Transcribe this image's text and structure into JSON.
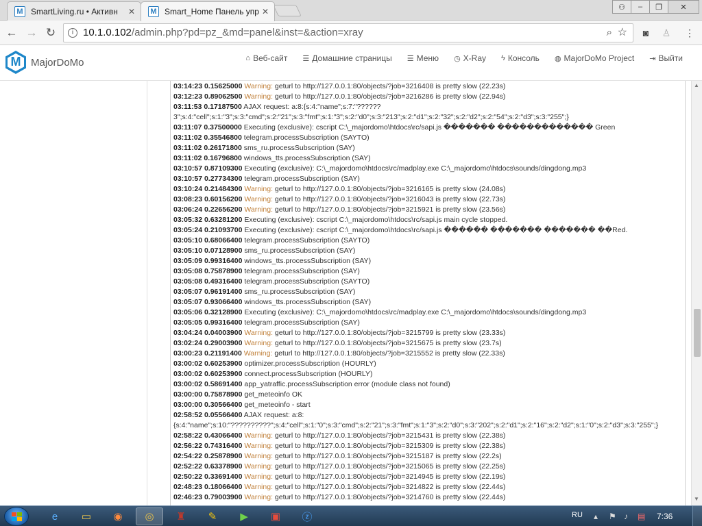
{
  "browser": {
    "tabs": [
      {
        "title": "SmartLiving.ru • Активн",
        "favicon": "M",
        "active": false
      },
      {
        "title": "Smart_Home Панель упр",
        "favicon": "M",
        "active": true
      }
    ],
    "url_host": "10.1.0.102",
    "url_path": "/admin.php?pd=pz_&md=panel&inst=&action=xray"
  },
  "site": {
    "brand": "MajorDoMo",
    "menu": [
      {
        "icon": "home-icon",
        "glyph": "⌂",
        "label": "Веб-сайт"
      },
      {
        "icon": "list-icon",
        "glyph": "☰",
        "label": "Домашние страницы"
      },
      {
        "icon": "list-icon",
        "glyph": "☰",
        "label": "Меню"
      },
      {
        "icon": "clock-icon",
        "glyph": "◷",
        "label": "X-Ray"
      },
      {
        "icon": "bolt-icon",
        "glyph": "ϟ",
        "label": "Консоль"
      },
      {
        "icon": "globe-icon",
        "glyph": "◍",
        "label": "MajorDoMo Project"
      },
      {
        "icon": "logout-icon",
        "glyph": "⇥",
        "label": "Выйти"
      }
    ]
  },
  "log": [
    {
      "time": "03:14:23",
      "val": "0.15625000",
      "warn": "Warning:",
      "msg": "geturl to http://127.0.0.1:80/objects/?job=3216408 is pretty slow (22.23s)"
    },
    {
      "time": "03:12:23",
      "val": "0.89062500",
      "warn": "Warning:",
      "msg": "geturl to http://127.0.0.1:80/objects/?job=3216286 is pretty slow (22.94s)"
    },
    {
      "time": "03:11:53",
      "val": "0.17187500",
      "warn": "",
      "msg": "AJAX request: a:8:{s:4:\"name\";s:7:\"??????"
    },
    {
      "time": "",
      "val": "",
      "warn": "",
      "msg": "3\";s:4:\"cell\";s:1:\"3\";s:3:\"cmd\";s:2:\"21\";s:3:\"fmt\";s:1:\"3\";s:2:\"d0\";s:3:\"213\";s:2:\"d1\";s:2:\"32\";s:2:\"d2\";s:2:\"54\";s:2:\"d3\";s:3:\"255\";}"
    },
    {
      "time": "03:11:07",
      "val": "0.37500000",
      "warn": "",
      "msg": "Executing (exclusive): cscript C:\\_majordomo\\htdocs\\rc/sapi.js ������� ������������� Green"
    },
    {
      "time": "03:11:02",
      "val": "0.35546800",
      "warn": "",
      "msg": "telegram.processSubscription (SAYTO)"
    },
    {
      "time": "03:11:02",
      "val": "0.26171800",
      "warn": "",
      "msg": "sms_ru.processSubscription (SAY)"
    },
    {
      "time": "03:11:02",
      "val": "0.16796800",
      "warn": "",
      "msg": "windows_tts.processSubscription (SAY)"
    },
    {
      "time": "03:10:57",
      "val": "0.87109300",
      "warn": "",
      "msg": "Executing (exclusive): C:\\_majordomo\\htdocs\\rc/madplay.exe C:\\_majordomo\\htdocs\\sounds/dingdong.mp3"
    },
    {
      "time": "03:10:57",
      "val": "0.27734300",
      "warn": "",
      "msg": "telegram.processSubscription (SAY)"
    },
    {
      "time": "03:10:24",
      "val": "0.21484300",
      "warn": "Warning:",
      "msg": "geturl to http://127.0.0.1:80/objects/?job=3216165 is pretty slow (24.08s)"
    },
    {
      "time": "03:08:23",
      "val": "0.60156200",
      "warn": "Warning:",
      "msg": "geturl to http://127.0.0.1:80/objects/?job=3216043 is pretty slow (22.73s)"
    },
    {
      "time": "03:06:24",
      "val": "0.22656200",
      "warn": "Warning:",
      "msg": "geturl to http://127.0.0.1:80/objects/?job=3215921 is pretty slow (23.56s)"
    },
    {
      "time": "03:05:32",
      "val": "0.63281200",
      "warn": "",
      "msg": "Executing (exclusive): cscript C:\\_majordomo\\htdocs\\rc/sapi.js main cycle stopped."
    },
    {
      "time": "03:05:24",
      "val": "0.21093700",
      "warn": "",
      "msg": "Executing (exclusive): cscript C:\\_majordomo\\htdocs\\rc/sapi.js ������ ������� ������� ��Red."
    },
    {
      "time": "03:05:10",
      "val": "0.68066400",
      "warn": "",
      "msg": "telegram.processSubscription (SAYTO)"
    },
    {
      "time": "03:05:10",
      "val": "0.07128900",
      "warn": "",
      "msg": "sms_ru.processSubscription (SAY)"
    },
    {
      "time": "03:05:09",
      "val": "0.99316400",
      "warn": "",
      "msg": "windows_tts.processSubscription (SAY)"
    },
    {
      "time": "03:05:08",
      "val": "0.75878900",
      "warn": "",
      "msg": "telegram.processSubscription (SAY)"
    },
    {
      "time": "03:05:08",
      "val": "0.49316400",
      "warn": "",
      "msg": "telegram.processSubscription (SAYTO)"
    },
    {
      "time": "03:05:07",
      "val": "0.96191400",
      "warn": "",
      "msg": "sms_ru.processSubscription (SAY)"
    },
    {
      "time": "03:05:07",
      "val": "0.93066400",
      "warn": "",
      "msg": "windows_tts.processSubscription (SAY)"
    },
    {
      "time": "03:05:06",
      "val": "0.32128900",
      "warn": "",
      "msg": "Executing (exclusive): C:\\_majordomo\\htdocs\\rc/madplay.exe C:\\_majordomo\\htdocs\\sounds/dingdong.mp3"
    },
    {
      "time": "03:05:05",
      "val": "0.99316400",
      "warn": "",
      "msg": "telegram.processSubscription (SAY)"
    },
    {
      "time": "03:04:24",
      "val": "0.04003900",
      "warn": "Warning:",
      "msg": "geturl to http://127.0.0.1:80/objects/?job=3215799 is pretty slow (23.33s)"
    },
    {
      "time": "03:02:24",
      "val": "0.29003900",
      "warn": "Warning:",
      "msg": "geturl to http://127.0.0.1:80/objects/?job=3215675 is pretty slow (23.7s)"
    },
    {
      "time": "03:00:23",
      "val": "0.21191400",
      "warn": "Warning:",
      "msg": "geturl to http://127.0.0.1:80/objects/?job=3215552 is pretty slow (22.33s)"
    },
    {
      "time": "03:00:02",
      "val": "0.60253900",
      "warn": "",
      "msg": "optimizer.processSubscription (HOURLY)"
    },
    {
      "time": "03:00:02",
      "val": "0.60253900",
      "warn": "",
      "msg": "connect.processSubscription (HOURLY)"
    },
    {
      "time": "03:00:02",
      "val": "0.58691400",
      "warn": "",
      "msg": "app_yatraffic.processSubscription error (module class not found)"
    },
    {
      "time": "03:00:00",
      "val": "0.75878900",
      "warn": "",
      "msg": "get_meteoinfo OK"
    },
    {
      "time": "03:00:00",
      "val": "0.30566400",
      "warn": "",
      "msg": "get_meteoinfo - start"
    },
    {
      "time": "02:58:52",
      "val": "0.05566400",
      "warn": "",
      "msg": "AJAX request: a:8:"
    },
    {
      "time": "",
      "val": "",
      "warn": "",
      "msg": "{s:4:\"name\";s:10:\"??????????\";s:4:\"cell\";s:1:\"0\";s:3:\"cmd\";s:2:\"21\";s:3:\"fmt\";s:1:\"3\";s:2:\"d0\";s:3:\"202\";s:2:\"d1\";s:2:\"16\";s:2:\"d2\";s:1:\"0\";s:2:\"d3\";s:3:\"255\";}"
    },
    {
      "time": "02:58:22",
      "val": "0.43066400",
      "warn": "Warning:",
      "msg": "geturl to http://127.0.0.1:80/objects/?job=3215431 is pretty slow (22.38s)"
    },
    {
      "time": "02:56:22",
      "val": "0.74316400",
      "warn": "Warning:",
      "msg": "geturl to http://127.0.0.1:80/objects/?job=3215309 is pretty slow (22.38s)"
    },
    {
      "time": "02:54:22",
      "val": "0.25878900",
      "warn": "Warning:",
      "msg": "geturl to http://127.0.0.1:80/objects/?job=3215187 is pretty slow (22.2s)"
    },
    {
      "time": "02:52:22",
      "val": "0.63378900",
      "warn": "Warning:",
      "msg": "geturl to http://127.0.0.1:80/objects/?job=3215065 is pretty slow (22.25s)"
    },
    {
      "time": "02:50:22",
      "val": "0.33691400",
      "warn": "Warning:",
      "msg": "geturl to http://127.0.0.1:80/objects/?job=3214945 is pretty slow (22.19s)"
    },
    {
      "time": "02:48:23",
      "val": "0.18066400",
      "warn": "Warning:",
      "msg": "geturl to http://127.0.0.1:80/objects/?job=3214822 is pretty slow (22.44s)"
    },
    {
      "time": "02:46:23",
      "val": "0.79003900",
      "warn": "Warning:",
      "msg": "geturl to http://127.0.0.1:80/objects/?job=3214760 is pretty slow (22.44s)"
    }
  ],
  "taskbar": {
    "lang": "RU",
    "clock": "7:36"
  },
  "colors": {
    "warning": "#c0803a",
    "brand": "#1e87c9",
    "taskbar": "#2c4a68"
  }
}
